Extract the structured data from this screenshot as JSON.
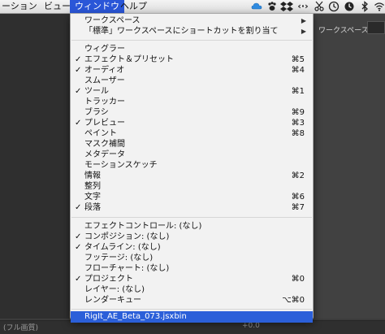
{
  "menubar": {
    "items": [
      {
        "label": "ーション"
      },
      {
        "label": "ビュー"
      },
      {
        "label": "ウィンドウ"
      },
      {
        "label": "ヘルプ"
      }
    ]
  },
  "app": {
    "workspace_label": "ワークスペース：",
    "status_left": "(フル画質)",
    "status_right": "+0.0"
  },
  "menu": {
    "group1": [
      {
        "label": "ワークスペース",
        "submenu": true
      },
      {
        "label": "「標準」ワークスペースにショートカットを割り当て",
        "submenu": true
      }
    ],
    "group2": [
      {
        "label": "ウィグラー",
        "check": "",
        "shortcut": ""
      },
      {
        "label": "エフェクト＆プリセット",
        "check": "✓",
        "shortcut": "⌘5"
      },
      {
        "label": "オーディオ",
        "check": "✓",
        "shortcut": "⌘4"
      },
      {
        "label": "スムーザー",
        "check": "",
        "shortcut": ""
      },
      {
        "label": "ツール",
        "check": "✓",
        "shortcut": "⌘1"
      },
      {
        "label": "トラッカー",
        "check": "",
        "shortcut": ""
      },
      {
        "label": "ブラシ",
        "check": "",
        "shortcut": "⌘9"
      },
      {
        "label": "プレビュー",
        "check": "✓",
        "shortcut": "⌘3"
      },
      {
        "label": "ペイント",
        "check": "",
        "shortcut": "⌘8"
      },
      {
        "label": "マスク補間",
        "check": "",
        "shortcut": ""
      },
      {
        "label": "メタデータ",
        "check": "",
        "shortcut": ""
      },
      {
        "label": "モーションスケッチ",
        "check": "",
        "shortcut": ""
      },
      {
        "label": "情報",
        "check": "",
        "shortcut": "⌘2"
      },
      {
        "label": "整列",
        "check": "",
        "shortcut": ""
      },
      {
        "label": "文字",
        "check": "",
        "shortcut": "⌘6"
      },
      {
        "label": "段落",
        "check": "✓",
        "shortcut": "⌘7"
      }
    ],
    "group3": [
      {
        "label": "エフェクトコントロール: (なし)",
        "check": "",
        "shortcut": ""
      },
      {
        "label": "コンポジション: (なし)",
        "check": "✓",
        "shortcut": ""
      },
      {
        "label": "タイムライン: (なし)",
        "check": "✓",
        "shortcut": ""
      },
      {
        "label": "フッテージ: (なし)",
        "check": "",
        "shortcut": ""
      },
      {
        "label": "フローチャート: (なし)",
        "check": "",
        "shortcut": ""
      },
      {
        "label": "プロジェクト",
        "check": "✓",
        "shortcut": "⌘0"
      },
      {
        "label": "レイヤー: (なし)",
        "check": "",
        "shortcut": ""
      },
      {
        "label": "レンダーキュー",
        "check": "",
        "shortcut": "⌥⌘0"
      }
    ],
    "group4": [
      {
        "label": "RigIt_AE_Beta_073.jsxbin"
      }
    ]
  },
  "colors": {
    "highlight": "#2b5fd9",
    "menubar_active": "#2a56d8"
  }
}
